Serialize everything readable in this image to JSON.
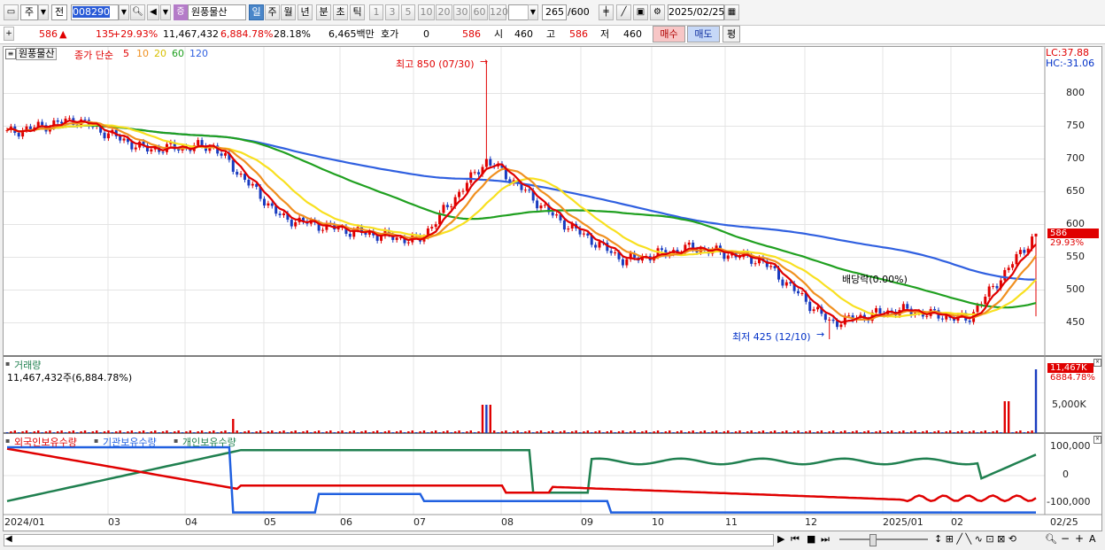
{
  "toolbar": {
    "market_label": "주",
    "prev_label": "전",
    "stock_code": "008290",
    "stock_name": "원풍물산",
    "stock_badge": "증",
    "periods": [
      "일",
      "주",
      "월",
      "년",
      "분",
      "초",
      "틱"
    ],
    "intervals": [
      "1",
      "3",
      "5",
      "10",
      "20",
      "30",
      "60",
      "120"
    ],
    "count": "265",
    "count_total": "/600",
    "date": "2025/02/25"
  },
  "quote": {
    "price": "586",
    "change": "135",
    "change_pct": "+29.93%",
    "volume": "11,467,432",
    "volume_pct": "6,884.78%",
    "turnover": "28.18%",
    "amount": "6,465백만",
    "hoga_label": "호가",
    "hoga_value": "0",
    "hoga_price": "586",
    "open_label": "시",
    "open": "460",
    "high_label": "고",
    "high": "586",
    "low_label": "저",
    "low": "460",
    "buy_label": "매수",
    "sell_label": "매도",
    "eval_label": "평"
  },
  "price_panel": {
    "name_tag": "원풍물산",
    "legend_prefix": "종가 단순",
    "ma_periods": [
      "5",
      "10",
      "20",
      "60",
      "120"
    ],
    "lc": "LC:37.88",
    "hc": "HC:-31.06",
    "y_ticks": [
      "800",
      "750",
      "700",
      "650",
      "600",
      "550",
      "500",
      "450"
    ],
    "current_tag": "586",
    "current_pct": "29.93%",
    "high_annot": "최고 850 (07/30)",
    "low_annot": "최저 425 (12/10)",
    "dividend_annot": "배당락(0.00%)"
  },
  "volume_panel": {
    "title": "거래량",
    "value_text": "11,467,432주(6,884.78%)",
    "y_tick": "5,000K",
    "current_tag": "11,467K",
    "current_pct": "6884.78%"
  },
  "holding_panel": {
    "legend": [
      "외국인보유수량",
      "기관보유수량",
      "개인보유수량"
    ],
    "legend_colors": [
      "#e00000",
      "#2060e0",
      "#208050"
    ],
    "y_ticks": [
      "100,000",
      "0",
      "-100,000"
    ]
  },
  "x_axis": [
    "2024/01",
    "03",
    "04",
    "05",
    "06",
    "07",
    "08",
    "09",
    "10",
    "11",
    "12",
    "2025/01",
    "02"
  ],
  "x_axis_right": "02/25",
  "colors": {
    "ma5": "#e00000",
    "ma10": "#f09020",
    "ma20": "#f8e020",
    "ma60": "#20a020",
    "ma120": "#3060e0",
    "up": "#e00000",
    "down": "#1a3cc0"
  },
  "chart_data": {
    "type": "candlestick",
    "dates_start": "2024/01",
    "dates_end": "2025/02/25",
    "price_range": [
      420,
      860
    ],
    "ohlc_sample": [
      {
        "t": "2024/01",
        "c": 740
      },
      {
        "t": "2024/02",
        "c": 760
      },
      {
        "t": "2024/03",
        "c": 715
      },
      {
        "t": "2024/04",
        "c": 720
      },
      {
        "t": "2024/05",
        "c": 610
      },
      {
        "t": "2024/06",
        "c": 590
      },
      {
        "t": "2024/07",
        "c": 575
      },
      {
        "t": "2024/07/30",
        "c": 700,
        "h": 850
      },
      {
        "t": "2024/08",
        "c": 610
      },
      {
        "t": "2024/09",
        "c": 545
      },
      {
        "t": "2024/10",
        "c": 565
      },
      {
        "t": "2024/11",
        "c": 545
      },
      {
        "t": "2024/12/10",
        "c": 450,
        "l": 425
      },
      {
        "t": "2025/01",
        "c": 470
      },
      {
        "t": "2025/02",
        "c": 455
      },
      {
        "t": "2025/02/25",
        "o": 460,
        "h": 586,
        "l": 460,
        "c": 586
      }
    ],
    "volume_last": 11467432
  }
}
